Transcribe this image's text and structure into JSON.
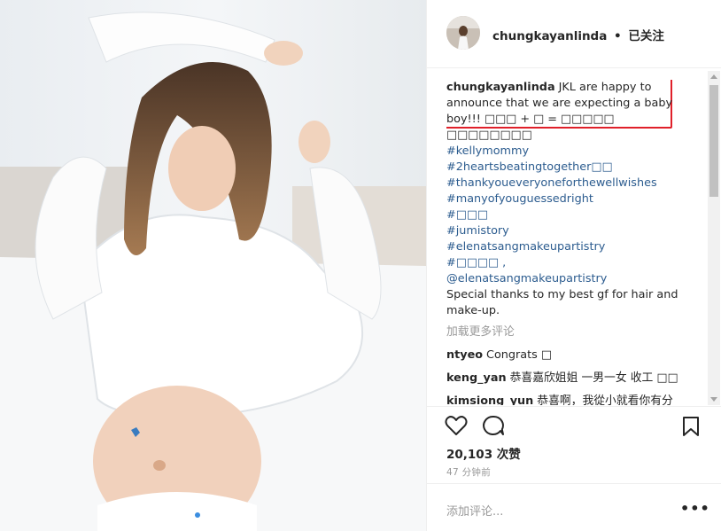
{
  "post": {
    "username": "chungkayanlinda",
    "separator": "•",
    "follow_status": "已关注",
    "caption_user": "chungkayanlinda",
    "caption_text": "JKL are happy to announce that we are expecting a baby boy!!! □□□ + □ = □□□□□ □□□□□□□□",
    "hashtags": [
      "#kellymommy",
      "#2heartsbeatingtogether□□",
      "#thankyoueveryoneforthewellwishes",
      "#manyofyouguessedright",
      "#□□□",
      "#jumistory",
      "#elenatsangmakeupartistry",
      "#□□□□ ,"
    ],
    "mention": "@elenatsangmakeupartistry",
    "thanks": "Special thanks to my best gf for hair and make-up.",
    "load_more": "加载更多评论",
    "comments": [
      {
        "user": "ntyeo",
        "text": "Congrats □"
      },
      {
        "user": "keng_yan",
        "text": "恭喜嘉欣姐姐 一男一女 收工 □□"
      },
      {
        "user": "kimsiong_yun",
        "text": "恭喜啊，我從小就看你有分"
      }
    ],
    "likes": "20,103 次赞",
    "time_ago": "47 分钟前",
    "add_comment_placeholder": "添加评论...",
    "more_label": "•••"
  },
  "icons": {
    "heart": "heart-icon",
    "comment": "comment-icon",
    "bookmark": "bookmark-icon",
    "more": "more-options-icon"
  },
  "colors": {
    "link": "#2c5c8f",
    "highlight_box": "#e0202a",
    "muted": "#999999",
    "carousel_active_dot": "#3b8de0"
  },
  "carousel": {
    "count": 4,
    "active_index": 0
  }
}
